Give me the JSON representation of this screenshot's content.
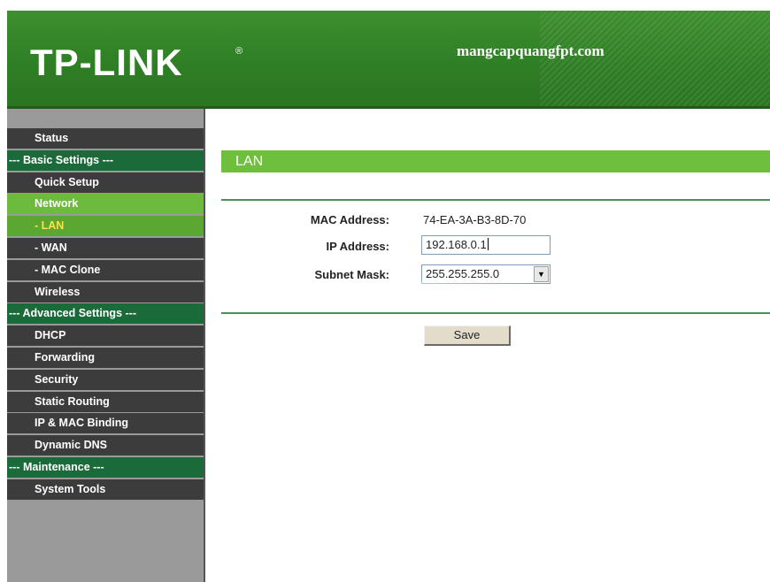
{
  "header": {
    "logo": "TP-LINK",
    "logo_mark": "®",
    "watermark": "mangcapquangfpt.com"
  },
  "sidebar": {
    "items": [
      {
        "label": "Status",
        "type": "item"
      },
      {
        "label": "--- Basic Settings ---",
        "type": "group"
      },
      {
        "label": "Quick Setup",
        "type": "item"
      },
      {
        "label": "Network",
        "type": "active"
      },
      {
        "label": "- LAN",
        "type": "active-sub"
      },
      {
        "label": "- WAN",
        "type": "sub"
      },
      {
        "label": "- MAC Clone",
        "type": "sub"
      },
      {
        "label": "Wireless",
        "type": "item"
      },
      {
        "label": "--- Advanced Settings ---",
        "type": "group"
      },
      {
        "label": "DHCP",
        "type": "item"
      },
      {
        "label": "Forwarding",
        "type": "item"
      },
      {
        "label": "Security",
        "type": "item"
      },
      {
        "label": "Static Routing",
        "type": "item"
      },
      {
        "label": "IP & MAC Binding",
        "type": "item"
      },
      {
        "label": "Dynamic DNS",
        "type": "item"
      },
      {
        "label": "--- Maintenance ---",
        "type": "group"
      },
      {
        "label": "System Tools",
        "type": "item"
      }
    ]
  },
  "main": {
    "title": "LAN",
    "mac_label": "MAC Address:",
    "mac_value": "74-EA-3A-B3-8D-70",
    "ip_label": "IP Address:",
    "ip_value": "192.168.0.1",
    "mask_label": "Subnet Mask:",
    "mask_value": "255.255.255.0",
    "save_label": "Save"
  },
  "colors": {
    "header_green": "#2f7f25",
    "title_bar_green": "#6fbf3f",
    "menu_dark": "#3c3c3c",
    "menu_group": "#1b6b3a",
    "menu_active": "#6cbb3c",
    "menu_active_sub_text": "#ffe14a"
  }
}
